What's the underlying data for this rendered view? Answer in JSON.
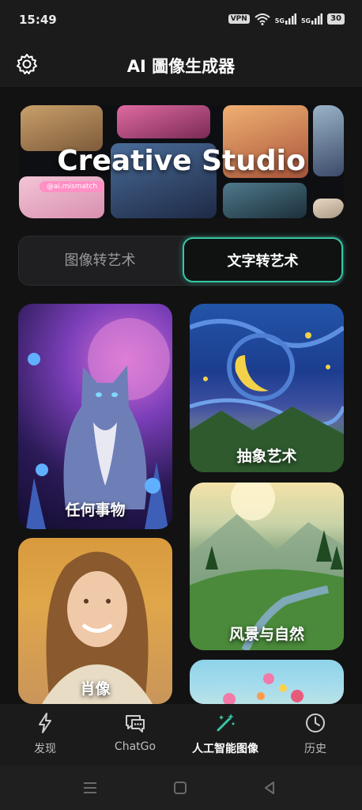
{
  "status_bar": {
    "time": "15:49",
    "vpn": "VPN",
    "signal1": "5G",
    "signal2": "5G",
    "battery": "30"
  },
  "header": {
    "title": "AI 圖像生成器",
    "settings_icon": "gear-icon"
  },
  "hero": {
    "title": "Creative Studio",
    "handle": "@ai.mismatch"
  },
  "tabs": {
    "image_to_art": "图像转艺术",
    "text_to_art": "文字转艺术"
  },
  "cards": {
    "anything": "任何事物",
    "abstract": "抽象艺术",
    "portrait": "肖像",
    "landscape": "风景与自然"
  },
  "nav": {
    "discover": "发现",
    "chatgo": "ChatGo",
    "ai_image": "人工智能图像",
    "history": "历史"
  },
  "colors": {
    "accent": "#35c8a6",
    "background": "#121212",
    "bar": "#1b1b1b"
  }
}
